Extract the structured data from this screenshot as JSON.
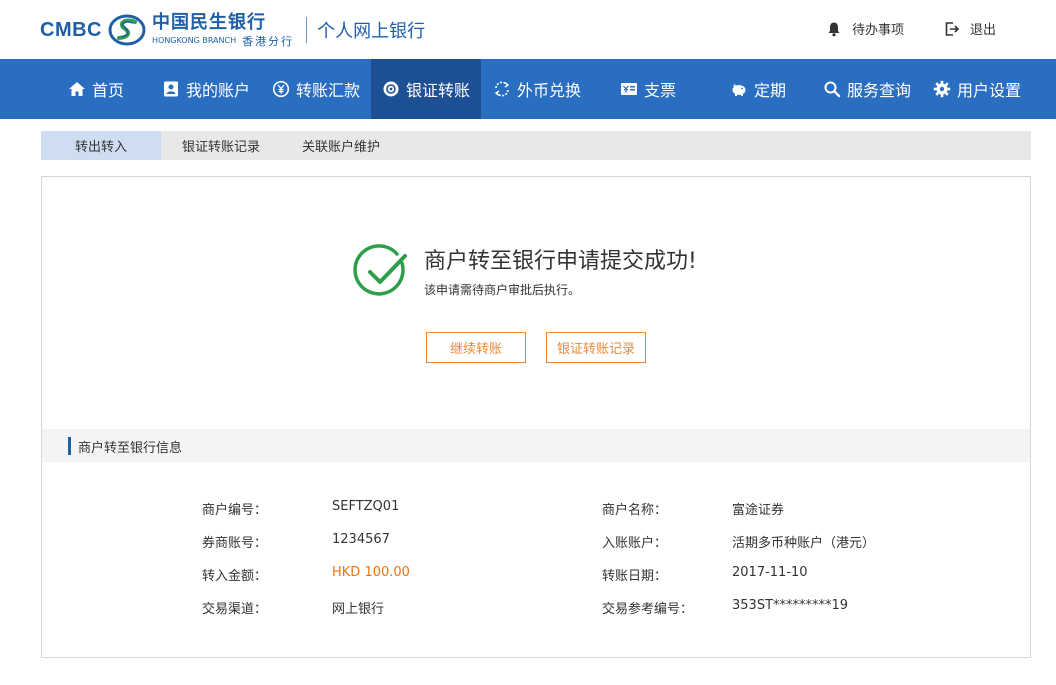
{
  "brand": {
    "cmbc": "CMBC",
    "cn_name": "中国民生银行",
    "branch_en": "HONGKONG BRANCH",
    "branch_cn": "香港分行",
    "site_title": "个人网上银行",
    "color": "#1f5fa8"
  },
  "header_links": {
    "todo": "待办事项",
    "logout": "退出"
  },
  "nav": {
    "items": [
      {
        "label": "首页",
        "icon": "home-icon"
      },
      {
        "label": "我的账户",
        "icon": "account-icon"
      },
      {
        "label": "转账汇款",
        "icon": "yen-transfer-icon"
      },
      {
        "label": "银证转账",
        "icon": "bank-securities-icon",
        "active": true
      },
      {
        "label": "外币兑换",
        "icon": "exchange-icon"
      },
      {
        "label": "支票",
        "icon": "cheque-icon"
      },
      {
        "label": "定期",
        "icon": "piggy-bank-icon"
      },
      {
        "label": "服务查询",
        "icon": "search-icon"
      },
      {
        "label": "用户设置",
        "icon": "gear-icon"
      }
    ],
    "bg_color": "#2a6ec1",
    "active_color": "#1d4f94"
  },
  "subnav": {
    "items": [
      {
        "label": "转出转入",
        "active": true
      },
      {
        "label": "银证转账记录"
      },
      {
        "label": "关联账户维护"
      }
    ]
  },
  "result": {
    "title": "商户转至银行申请提交成功!",
    "subtitle": "该申请需待商户审批后执行。",
    "continue_button": "继续转账",
    "records_button": "银证转账记录",
    "check_color": "#2e9e4a"
  },
  "details": {
    "section_title": "商户转至银行信息",
    "left": [
      {
        "label": "商户编号：",
        "value": "SEFTZQ01"
      },
      {
        "label": "券商账号：",
        "value": "1234567"
      },
      {
        "label": "转入金额：",
        "value": "HKD 100.00"
      },
      {
        "label": "交易渠道：",
        "value": "网上银行"
      }
    ],
    "right": [
      {
        "label": "商户名称：",
        "value": "富途证券"
      },
      {
        "label": "入账账户：",
        "value": "活期多币种账户（港元）"
      },
      {
        "label": "转账日期：",
        "value": "2017-11-10"
      },
      {
        "label": "交易参考编号：",
        "value": "353ST*********19"
      }
    ],
    "amount_color": "#e8760f"
  }
}
